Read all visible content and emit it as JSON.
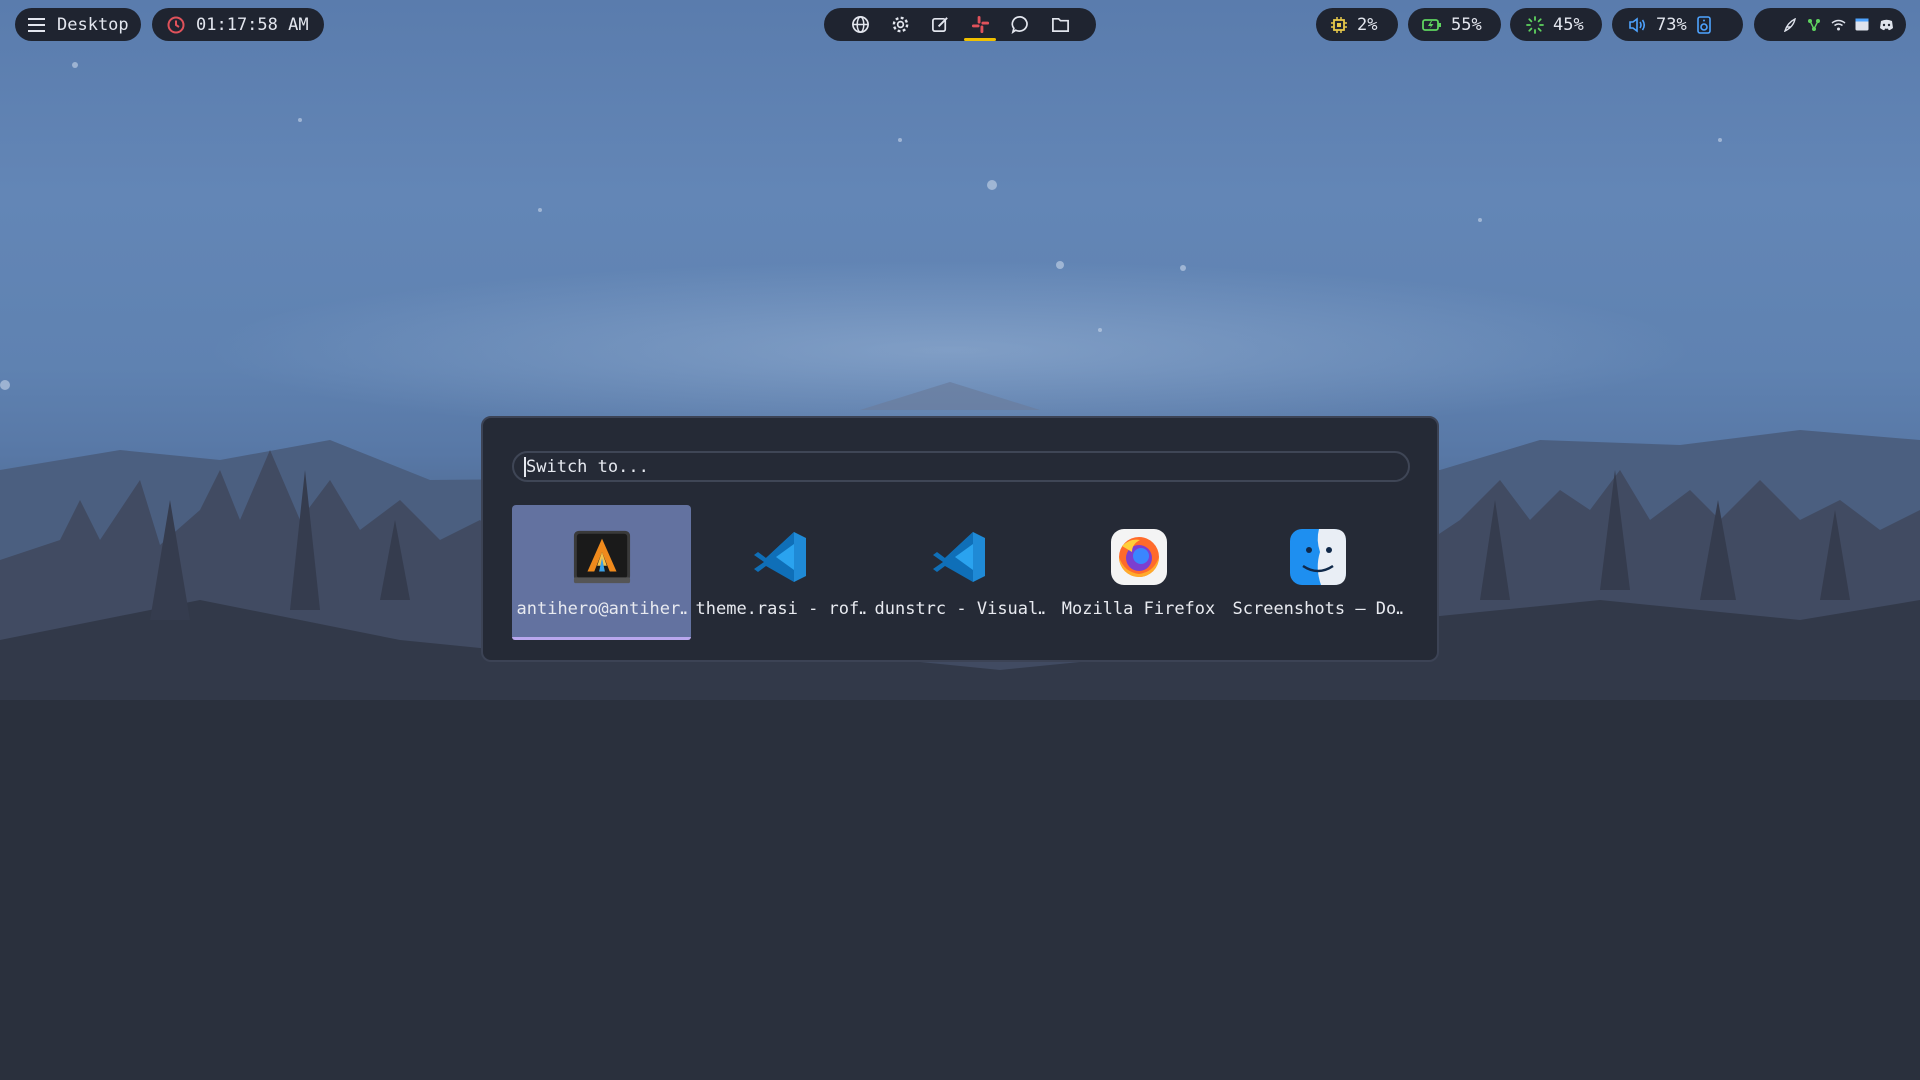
{
  "topbar": {
    "menu": {
      "icon": "hamburger-menu-icon",
      "label": "Desktop"
    },
    "clock": {
      "icon": "clock-icon",
      "time": "01:17:58 AM",
      "accent": "#e0525b"
    },
    "dock": [
      {
        "name": "browser",
        "icon": "globe-icon"
      },
      {
        "name": "settings",
        "icon": "gear-icon"
      },
      {
        "name": "editor",
        "icon": "edit-icon"
      },
      {
        "name": "slack",
        "icon": "slack-icon",
        "active": true
      },
      {
        "name": "chat",
        "icon": "chat-bubble-icon"
      },
      {
        "name": "files",
        "icon": "folder-icon"
      }
    ],
    "stats": {
      "cpu": {
        "icon": "cpu-chip-icon",
        "value": "2%",
        "color": "#e6c84a"
      },
      "battery": {
        "icon": "battery-charging-icon",
        "value": "55%",
        "color": "#5fd35f"
      },
      "brightness": {
        "icon": "brightness-icon",
        "value": "45%",
        "color": "#5fd35f"
      },
      "volume": {
        "icon": "volume-icon",
        "value": "73%",
        "color": "#4ea3ff"
      }
    },
    "tray": [
      "feather-icon",
      "network-tree-icon",
      "wifi-icon",
      "window-icon",
      "discord-icon"
    ]
  },
  "switcher": {
    "search": {
      "placeholder": "Switch to..."
    },
    "items": [
      {
        "label": "antihero@antiher…",
        "icon": "alacritty-terminal-icon",
        "selected": true
      },
      {
        "label": "theme.rasi - rof…",
        "icon": "vscode-icon"
      },
      {
        "label": "dunstrc - Visual…",
        "icon": "vscode-icon"
      },
      {
        "label": "Mozilla Firefox",
        "icon": "firefox-icon"
      },
      {
        "label": "Screenshots — Do…",
        "icon": "finder-icon"
      }
    ],
    "accent": "#6372a0"
  }
}
